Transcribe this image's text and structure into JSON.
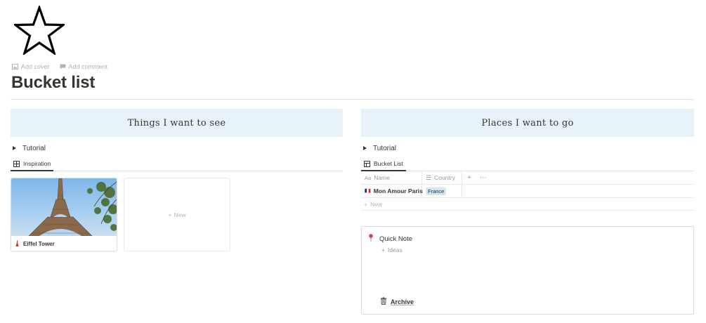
{
  "page": {
    "icon": "star-icon",
    "title": "Bucket list",
    "add_cover": "Add cover",
    "add_comment": "Add comment"
  },
  "left": {
    "header": "Things I want to see",
    "toggle": "Tutorial",
    "view_tab": "Inspiration",
    "gallery": [
      {
        "title": "Eiffel Tower",
        "icon": "tower-icon"
      }
    ],
    "new_label": "New"
  },
  "right": {
    "header": "Places I want to go",
    "toggle": "Tutorial",
    "view_tab": "Bucket List",
    "columns": [
      "Name",
      "Country"
    ],
    "rows": [
      {
        "flag": "🇫🇷",
        "name": "Mon Amour Paris",
        "country": "France"
      }
    ],
    "new_label": "New"
  },
  "quick_note": {
    "title": "Quick Note",
    "add_label": "Ideas",
    "archive_label": "Archive"
  },
  "colors": {
    "callout_bg": "#e7f3f8",
    "tag_bg": "#d3e5ef",
    "text": "#37352f"
  }
}
